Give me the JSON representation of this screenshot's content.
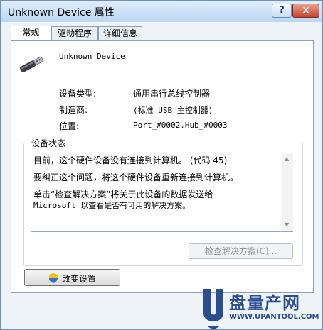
{
  "window": {
    "title": "Unknown Device 属性",
    "help_label": "?",
    "close_label": "x"
  },
  "tabs": [
    {
      "label": "常规",
      "active": true
    },
    {
      "label": "驱动程序",
      "active": false
    },
    {
      "label": "详细信息",
      "active": false
    }
  ],
  "device": {
    "name": "Unknown Device",
    "icon": "usb-plug-icon",
    "type_label": "设备类型:",
    "type_value": "通用串行总线控制器",
    "manufacturer_label": "制造商:",
    "manufacturer_value": "(标准 USB 主控制器)",
    "location_label": "位置:",
    "location_value": "Port_#0002.Hub_#0003"
  },
  "status": {
    "group_label": "设备状态",
    "line1": "目前，这个硬件设备没有连接到计算机。 (代码 45)",
    "line2": "要纠正这个问题，将这个硬件设备重新连接到计算机。",
    "line3a": "单击“检查解决方案”将关于此设备的数据发送给",
    "line3b": "Microsoft 以查看是否有可用的解决方案。"
  },
  "buttons": {
    "troubleshoot_label": "检查解决方案(C)...",
    "change_settings_label": "改变设置"
  },
  "watermark": {
    "letter": "U",
    "name": "盘量产网",
    "url": "WWW.UPANTOOL.COM"
  },
  "colors": {
    "title_bg": "#bcd6f2",
    "close_button": "#c4452e",
    "watermark": "#2b4e8e"
  }
}
